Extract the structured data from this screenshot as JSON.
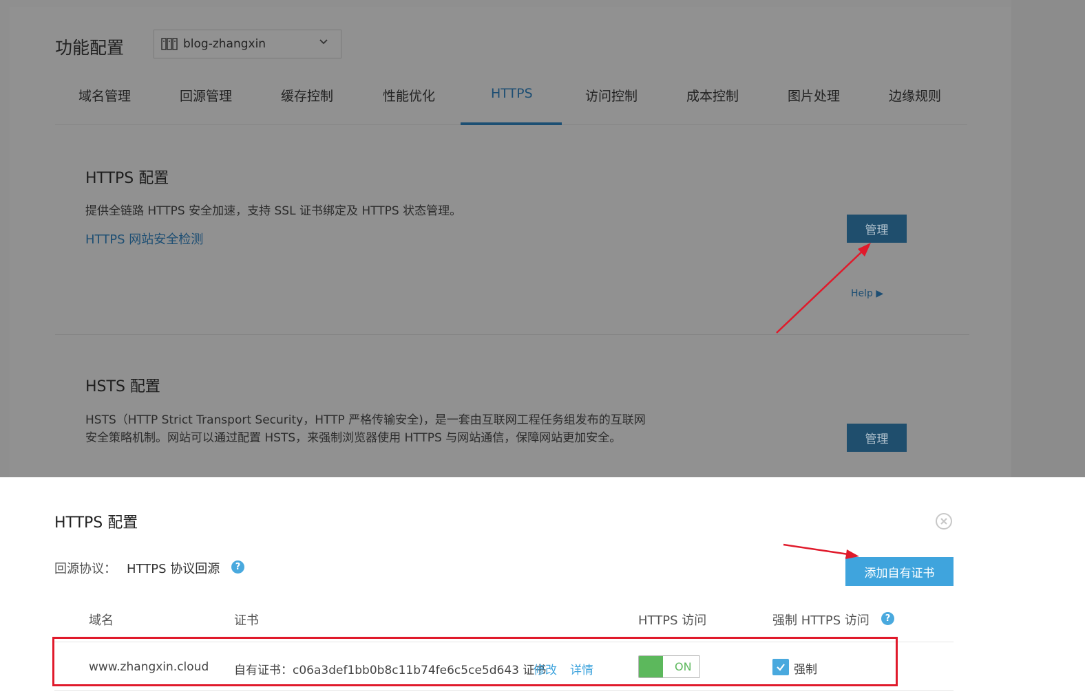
{
  "background_page": {
    "title": "功能配置",
    "domain_select": {
      "value": "blog-zhangxin",
      "icon": "cdn-domain-icon"
    },
    "tabs": [
      {
        "label": "域名管理",
        "active": false
      },
      {
        "label": "回源管理",
        "active": false
      },
      {
        "label": "缓存控制",
        "active": false
      },
      {
        "label": "性能优化",
        "active": false
      },
      {
        "label": "HTTPS",
        "active": true
      },
      {
        "label": "访问控制",
        "active": false
      },
      {
        "label": "成本控制",
        "active": false
      },
      {
        "label": "图片处理",
        "active": false
      },
      {
        "label": "边缘规则",
        "active": false
      }
    ],
    "https_section": {
      "title": "HTTPS 配置",
      "desc": "提供全链路 HTTPS 安全加速，支持 SSL 证书绑定及 HTTPS 状态管理。",
      "link": "HTTPS 网站安全检测",
      "manage_label": "管理",
      "help_label": "Help ▶"
    },
    "hsts_section": {
      "title": "HSTS 配置",
      "desc_line1": "HSTS（HTTP Strict Transport Security，HTTP 严格传输安全)，是一套由互联网工程任务组发布的互联网",
      "desc_line2": "安全策略机制。网站可以通过配置 HSTS，来强制浏览器使用 HTTPS 与网站通信，保障网站更加安全。",
      "manage_label": "管理"
    }
  },
  "modal": {
    "title": "HTTPS 配置",
    "origin_protocol_label": "回源协议：",
    "origin_protocol_value": "HTTPS 协议回源",
    "add_cert_label": "添加自有证书",
    "table": {
      "headers": {
        "domain": "域名",
        "cert": "证书",
        "https_access": "HTTPS 访问",
        "force_https": "强制 HTTPS 访问"
      },
      "rows": [
        {
          "domain": "www.zhangxin.cloud",
          "cert": "自有证书：c06a3def1bb0b8c11b74fe6c5ce5d643 证书",
          "edit_label": "修改",
          "detail_label": "详情",
          "https_toggle": "ON",
          "force_label": "强制",
          "force_checked": true
        }
      ]
    }
  },
  "colors": {
    "accent_blue": "#3fa4dd",
    "toggle_green": "#5cb85c",
    "annotation_red": "#e01a2b"
  }
}
